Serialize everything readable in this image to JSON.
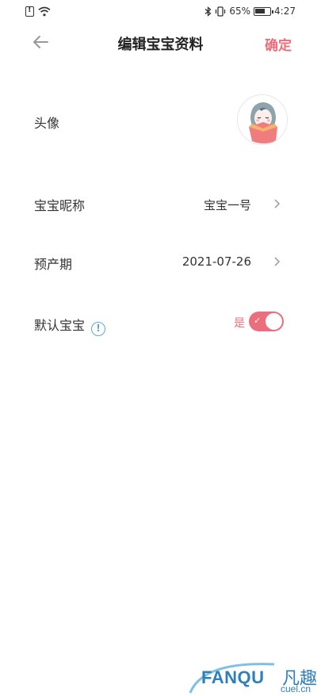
{
  "status_bar": {
    "battery": "65%",
    "time": "4:27"
  },
  "nav": {
    "title": "编辑宝宝资料",
    "confirm_label": "确定"
  },
  "form": {
    "avatar_label": "头像",
    "nickname_label": "宝宝昵称",
    "nickname_value": "宝宝一号",
    "due_date_label": "预产期",
    "due_date_value": "2021-07-26",
    "default_label": "默认宝宝",
    "default_toggle_text": "是",
    "default_toggle_on": true
  },
  "watermark": {
    "brand": "FANQU",
    "brand_cn": "凡趣",
    "domain": "cuel.cn"
  },
  "colors": {
    "accent": "#ec6e7c",
    "info": "#5aa7d6",
    "watermark": "#2f7fb9"
  }
}
